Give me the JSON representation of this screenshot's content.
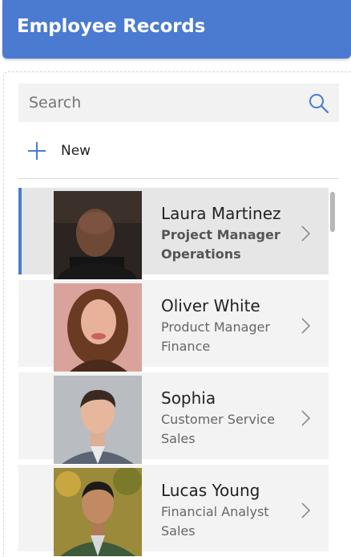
{
  "header": {
    "title": "Employee Records"
  },
  "search": {
    "placeholder": "Search"
  },
  "toolbar": {
    "new_label": "New"
  },
  "colors": {
    "accent": "#4a7bd1",
    "header_bg": "#4a7bd1",
    "row_bg": "#f3f3f3",
    "selected_row_bg": "#e6e6e6"
  },
  "icons": {
    "search": "search-icon",
    "new": "plus-icon",
    "row_action": "chevron-right-icon"
  },
  "employees": [
    {
      "name": "Laura Martinez",
      "title": "Project Manager",
      "department": "Operations",
      "selected": true
    },
    {
      "name": "Oliver White",
      "title": "Product Manager",
      "department": "Finance",
      "selected": false
    },
    {
      "name": "Sophia",
      "title": "Customer Service",
      "department": "Sales",
      "selected": false
    },
    {
      "name": "Lucas Young",
      "title": "Financial Analyst",
      "department": "Sales",
      "selected": false
    }
  ]
}
